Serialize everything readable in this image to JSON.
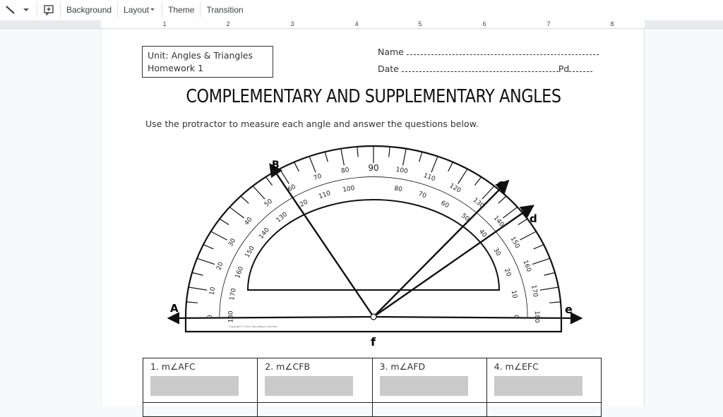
{
  "toolbar": {
    "items": [
      {
        "label": "Background"
      },
      {
        "label": "Layout"
      },
      {
        "label": "Theme"
      },
      {
        "label": "Transition"
      }
    ],
    "icons": [
      "line-icon",
      "chevron-down-icon",
      "add-comment-icon"
    ]
  },
  "ruler": {
    "numbers": [
      "1",
      "2",
      "3",
      "4",
      "5",
      "6",
      "7",
      "8"
    ]
  },
  "worksheet": {
    "unit_line1": "Unit:  Angles & Triangles",
    "unit_line2": "Homework 1",
    "name_label": "Name",
    "date_label": "Date",
    "pd_label": "Pd",
    "title": "COMPLEMENTARY AND SUPPLEMENTARY ANGLES",
    "instructions": "Use the protractor to measure each angle and answer the questions below.",
    "points": {
      "A": "A",
      "B": "B",
      "C": "C",
      "d": "d",
      "e": "e",
      "f": "f"
    },
    "protractor_center_label": "90",
    "copyright": "Copyright © 2014 Sprouting in Second",
    "questions": [
      {
        "label": "1. m∠AFC"
      },
      {
        "label": "2. m∠CFB"
      },
      {
        "label": "3. m∠AFD"
      },
      {
        "label": "4. m∠EFC"
      }
    ],
    "answer_box_color": "#cacaca"
  }
}
